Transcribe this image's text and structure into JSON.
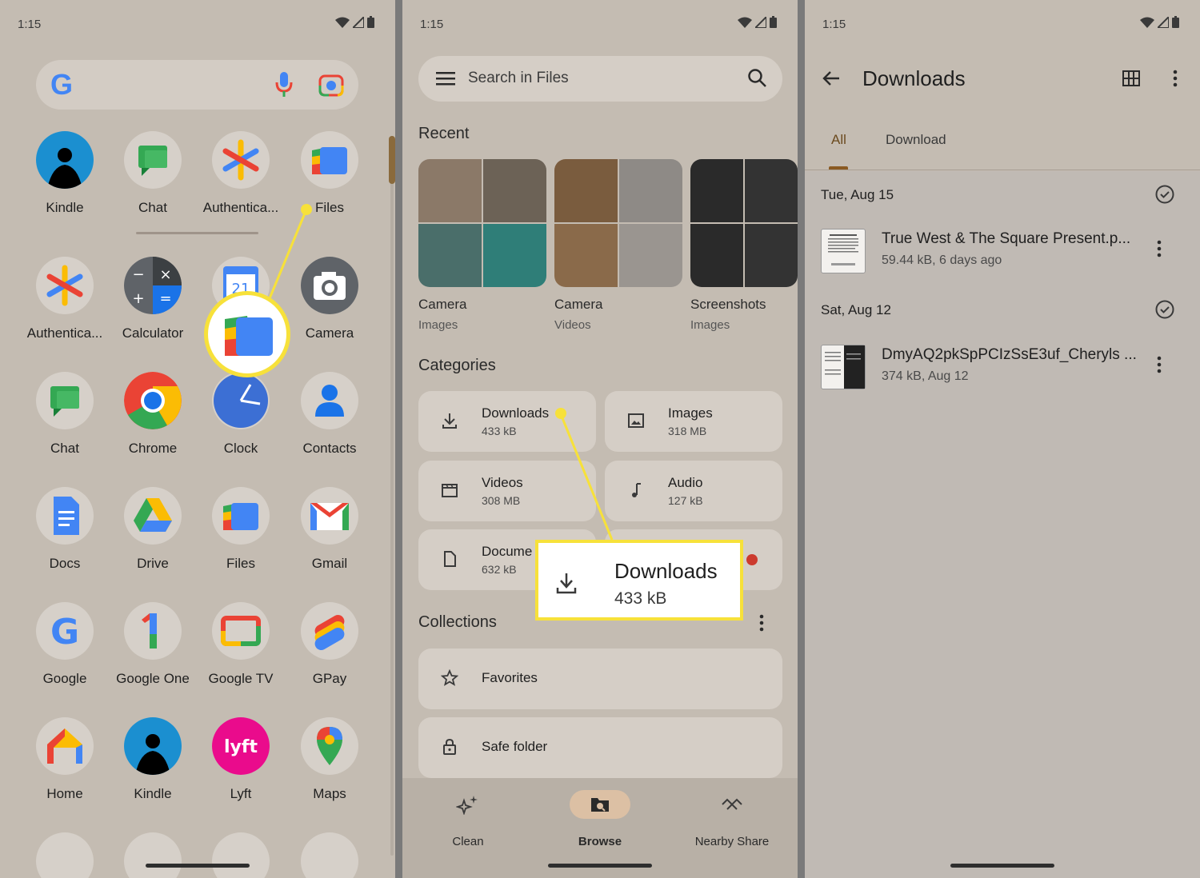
{
  "status": {
    "time": "1:15"
  },
  "launcher": {
    "search_logo": "G",
    "apps": [
      {
        "label": "Kindle",
        "icon": "kindle-icon"
      },
      {
        "label": "Chat",
        "icon": "chat-icon"
      },
      {
        "label": "Authentica...",
        "icon": "authenticator-icon"
      },
      {
        "label": "Files",
        "icon": "files-icon"
      },
      {
        "label": "Authentica...",
        "icon": "authenticator-icon"
      },
      {
        "label": "Calculator",
        "icon": "calculator-icon"
      },
      {
        "label": "",
        "icon": "calendar-icon"
      },
      {
        "label": "Camera",
        "icon": "camera-icon"
      },
      {
        "label": "Chat",
        "icon": "chat-icon"
      },
      {
        "label": "Chrome",
        "icon": "chrome-icon"
      },
      {
        "label": "Clock",
        "icon": "clock-icon"
      },
      {
        "label": "Contacts",
        "icon": "contacts-icon"
      },
      {
        "label": "Docs",
        "icon": "docs-icon"
      },
      {
        "label": "Drive",
        "icon": "drive-icon"
      },
      {
        "label": "Files",
        "icon": "files-icon"
      },
      {
        "label": "Gmail",
        "icon": "gmail-icon"
      },
      {
        "label": "Google",
        "icon": "google-icon"
      },
      {
        "label": "Google One",
        "icon": "google-one-icon"
      },
      {
        "label": "Google TV",
        "icon": "google-tv-icon"
      },
      {
        "label": "GPay",
        "icon": "gpay-icon"
      },
      {
        "label": "Home",
        "icon": "home-icon"
      },
      {
        "label": "Kindle",
        "icon": "kindle-icon"
      },
      {
        "label": "Lyft",
        "icon": "lyft-icon"
      },
      {
        "label": "Maps",
        "icon": "maps-icon"
      }
    ],
    "calendar_day": "21",
    "lyft_text": "lyft"
  },
  "files": {
    "search_placeholder": "Search in Files",
    "recent_heading": "Recent",
    "recent": [
      {
        "label": "Camera",
        "sub": "Images"
      },
      {
        "label": "Camera",
        "sub": "Videos"
      },
      {
        "label": "Screenshots",
        "sub": "Images"
      }
    ],
    "categories_heading": "Categories",
    "categories": [
      {
        "name": "Downloads",
        "size": "433 kB"
      },
      {
        "name": "Images",
        "size": "318 MB"
      },
      {
        "name": "Videos",
        "size": "308 MB"
      },
      {
        "name": "Audio",
        "size": "127 kB"
      },
      {
        "name": "Docume",
        "size": "632 kB"
      }
    ],
    "collections_heading": "Collections",
    "collections": [
      {
        "name": "Favorites"
      },
      {
        "name": "Safe folder"
      }
    ],
    "nav": [
      {
        "label": "Clean"
      },
      {
        "label": "Browse"
      },
      {
        "label": "Nearby Share"
      }
    ],
    "callout": {
      "name": "Downloads",
      "size": "433 kB"
    }
  },
  "downloads": {
    "title": "Downloads",
    "tabs": [
      {
        "label": "All"
      },
      {
        "label": "Download"
      }
    ],
    "groups": [
      {
        "date": "Tue, Aug 15",
        "file": {
          "name": "True West & The Square Present.p...",
          "meta": "59.44 kB, 6 days ago"
        }
      },
      {
        "date": "Sat, Aug 12",
        "file": {
          "name": "DmyAQ2pkSpPCIzSsE3uf_Cheryls ...",
          "meta": "374 kB, Aug 12"
        }
      }
    ]
  },
  "colors": {
    "highlight": "#f7e13a",
    "background": "#c4bcb2",
    "accent": "#8a5a22"
  }
}
